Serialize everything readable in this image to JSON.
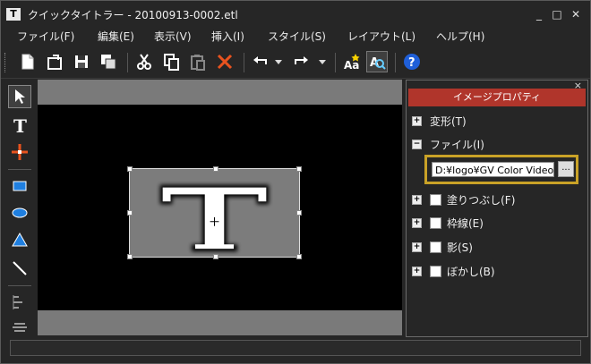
{
  "window": {
    "app_icon": "T",
    "title": "クイックタイトラー - 20100913-0002.etl",
    "controls": {
      "minimize": "_",
      "maximize": "□",
      "close": "✕"
    }
  },
  "menu": [
    {
      "label": "ファイル(F)"
    },
    {
      "label": "編集(E)"
    },
    {
      "label": "表示(V)"
    },
    {
      "label": "挿入(I)"
    },
    {
      "label": "スタイル(S)"
    },
    {
      "label": "レイアウト(L)"
    },
    {
      "label": "ヘルプ(H)"
    }
  ],
  "toolbar": {
    "icons": [
      "new-file-icon",
      "open-file-icon",
      "save-icon",
      "save-as-icon",
      "cut-icon",
      "copy-icon",
      "paste-icon",
      "delete-icon",
      "undo-icon",
      "redo-icon",
      "text-style-icon",
      "text-search-icon",
      "help-icon"
    ],
    "help_label": "?"
  },
  "left_tools": [
    "pointer-icon",
    "text-tool-icon",
    "crosshair-tool-icon",
    "rectangle-tool-icon",
    "ellipse-tool-icon",
    "triangle-tool-icon",
    "line-tool-icon",
    "align-tool-icon",
    "distribute-tool-icon"
  ],
  "canvas": {
    "logo_letter": "T"
  },
  "properties": {
    "title": "イメージプロパティ",
    "close": "×",
    "sections": {
      "transform": "変形(T)",
      "file": "ファイル(I)",
      "fill": "塗りつぶし(F)",
      "border": "枠線(E)",
      "shadow": "影(S)",
      "blur": "ぼかし(B)"
    },
    "file_path": "D:¥logo¥GV Color Video-I",
    "browse_label": "...",
    "expand_symbol": "+",
    "collapse_symbol": "−"
  }
}
